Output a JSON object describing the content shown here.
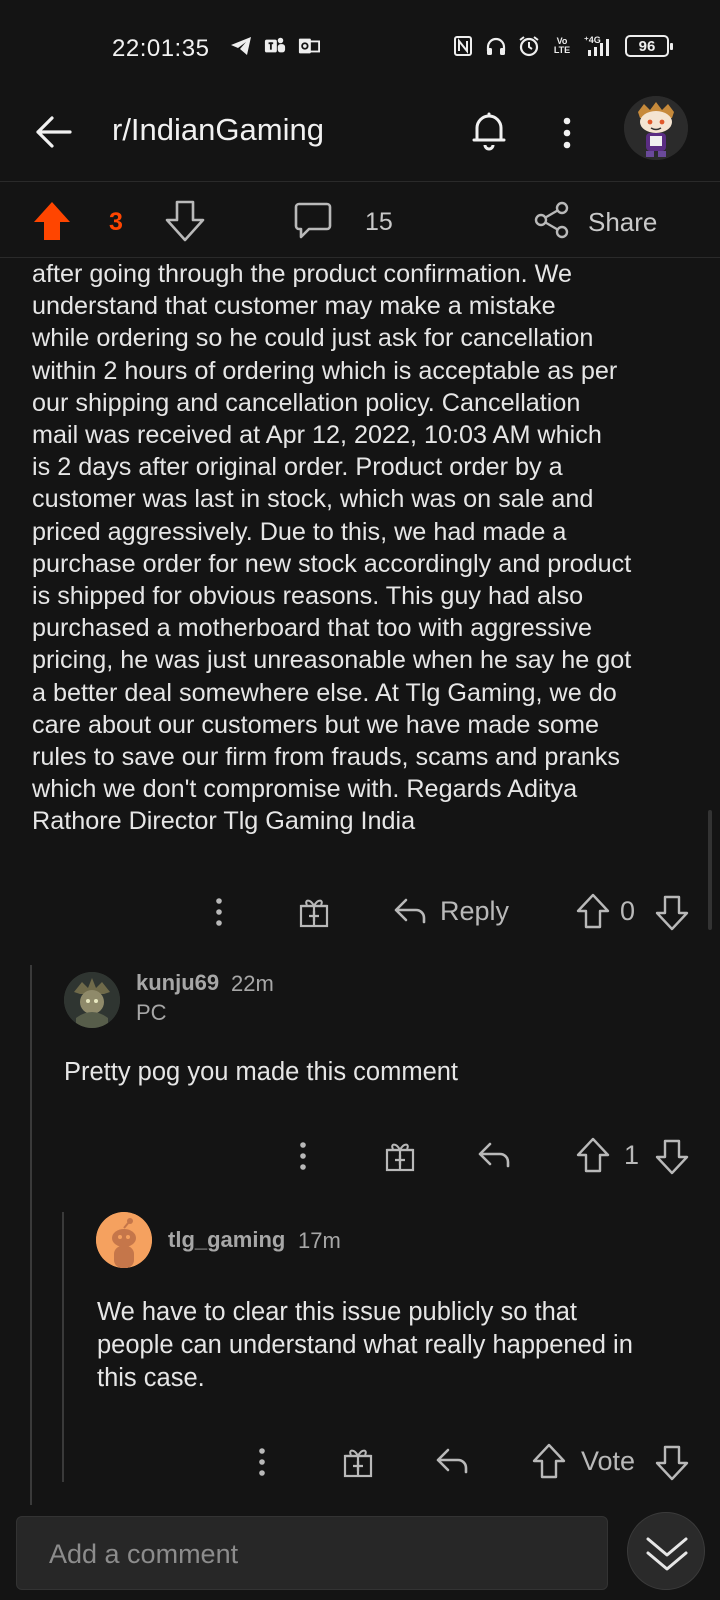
{
  "status_bar": {
    "time": "22:01:35",
    "left_icons": [
      "telegram-icon",
      "teams-icon",
      "outlook-icon"
    ],
    "right_icons": [
      "nfc-icon",
      "headphones-icon",
      "alarm-icon",
      "volte-icon",
      "4g-signal-icon"
    ],
    "volte_label": "Vo LTE",
    "network_label": "4G",
    "battery": "96"
  },
  "header": {
    "subreddit": "r/IndianGaming",
    "icons": [
      "back-arrow-icon",
      "bell-icon",
      "more-vertical-icon",
      "avatar"
    ]
  },
  "post_bar": {
    "score": "3",
    "comments": "15",
    "share_label": "Share",
    "accent": "#ff4500"
  },
  "main_comment": {
    "lines": [
      "after going through the product confirmation. We",
      "understand that customer may make a mistake",
      "while ordering so he could just ask for cancellation",
      "within 2 hours of ordering which is acceptable as per",
      "our shipping and cancellation policy. Cancellation",
      "mail was received at Apr 12, 2022, 10:03 AM which",
      "is 2 days after original order. Product order by a",
      "customer was last in stock, which was on sale and",
      "priced aggressively. Due to this, we had made a",
      "purchase order for new stock accordingly and product",
      "is shipped for obvious reasons. This guy had also",
      "purchased a motherboard that too with aggressive",
      "pricing, he was just unreasonable when he say he got",
      "a better deal somewhere else. At Tlg Gaming, we do",
      "care about our customers but we have made some",
      "rules to save our firm from frauds, scams and pranks",
      "which we don't compromise with. Regards Aditya",
      "Rathore Director Tlg Gaming India"
    ],
    "reply_label": "Reply",
    "score": "0"
  },
  "reply1": {
    "username": "kunju69",
    "time": "22m",
    "flair": "PC",
    "body": "Pretty pog you made this comment",
    "score": "1"
  },
  "reply2": {
    "username": "tlg_gaming",
    "time": "17m",
    "body_lines": [
      "We have to clear this issue publicly so that",
      "people can understand what really happened in",
      "this case."
    ],
    "vote_label": "Vote"
  },
  "bottom": {
    "placeholder": "Add a comment"
  }
}
